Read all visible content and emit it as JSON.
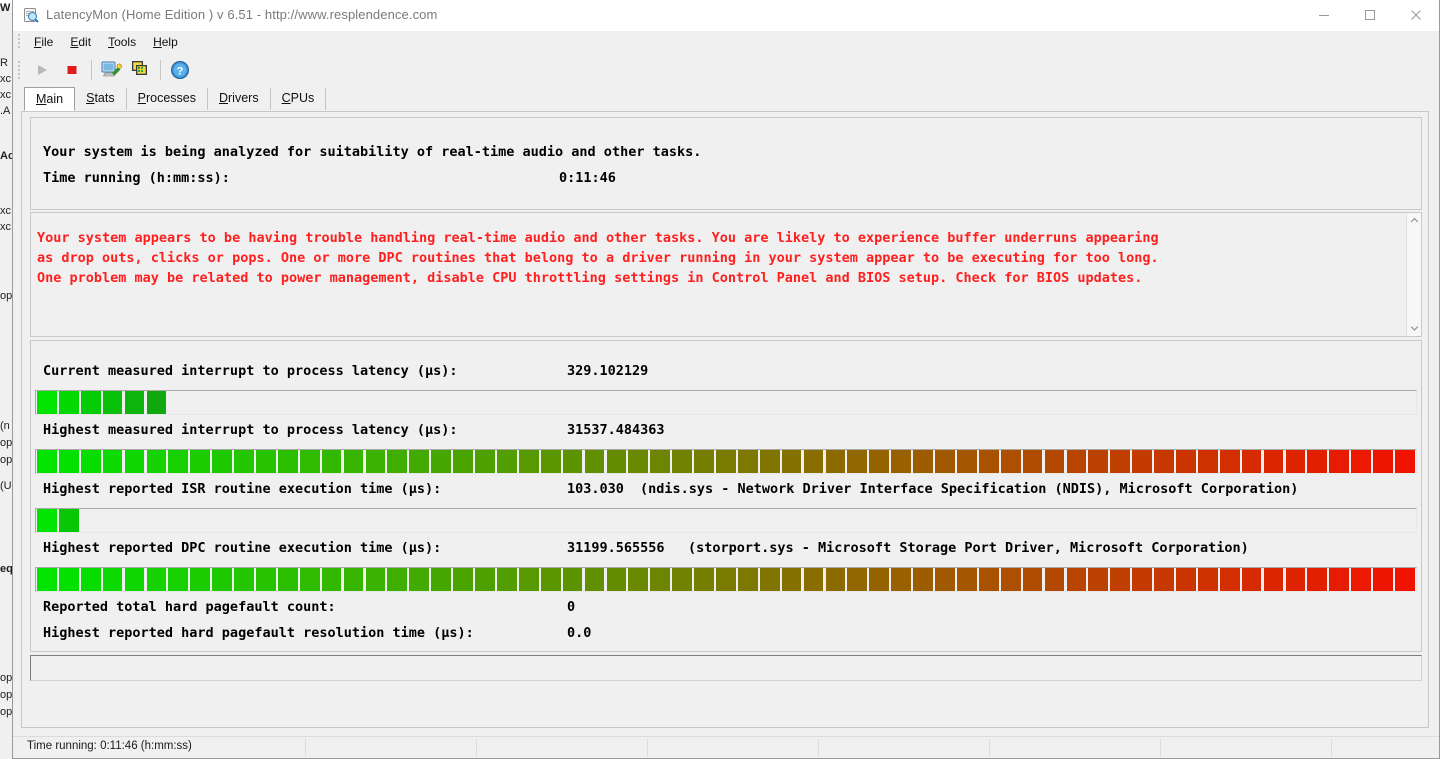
{
  "window": {
    "title": "LatencyMon  (Home Edition )  v 6.51 - http://www.resplendence.com",
    "icon": "latencymon-icon",
    "minimize_label": "Minimize",
    "maximize_label": "Maximize",
    "close_label": "Close"
  },
  "menu": {
    "items": [
      {
        "label": "File",
        "accel": "F"
      },
      {
        "label": "Edit",
        "accel": "E"
      },
      {
        "label": "Tools",
        "accel": "T"
      },
      {
        "label": "Help",
        "accel": "H"
      }
    ]
  },
  "toolbar": {
    "buttons": [
      {
        "name": "start-monitoring-button",
        "icon": "play-icon",
        "enabled": false
      },
      {
        "name": "stop-monitoring-button",
        "icon": "stop-icon",
        "enabled": true
      },
      {
        "name": "system-info-button",
        "icon": "computer-wrench-icon",
        "enabled": true
      },
      {
        "name": "copy-report-button",
        "icon": "copy-windows-icon",
        "enabled": true
      },
      {
        "name": "help-button",
        "icon": "help-question-icon",
        "enabled": true
      }
    ]
  },
  "tabs": [
    {
      "label": "Main",
      "accel": "M",
      "active": true
    },
    {
      "label": "Stats",
      "accel": "S",
      "active": false
    },
    {
      "label": "Processes",
      "accel": "P",
      "active": false
    },
    {
      "label": "Drivers",
      "accel": "D",
      "active": false
    },
    {
      "label": "CPUs",
      "accel": "C",
      "active": false
    }
  ],
  "summary": {
    "headline": "Your system is being analyzed for suitability of real-time audio and other tasks.",
    "time_label": "Time running (h:mm:ss):",
    "time_value": "0:11:46"
  },
  "warning": {
    "color": "#ff1f1f",
    "lines": [
      "Your system appears to be having trouble handling real-time audio and other tasks. You are likely to experience buffer underruns appearing",
      "as drop outs, clicks or pops. One or more DPC routines that belong to a driver running in your system appear to be executing for too long.",
      "One problem may be related to power management, disable CPU throttling settings in Control Panel and BIOS setup. Check for BIOS updates."
    ],
    "scroll_up_icon": "chevron-up-icon",
    "scroll_down_icon": "chevron-down-icon"
  },
  "metrics": [
    {
      "name": "current-interrupt-to-process-latency",
      "label": "Current measured interrupt to process latency (µs):",
      "value": "329.102129",
      "extra": "",
      "bar": {
        "segments": 6,
        "total_segments": 63,
        "start_color": "#00e400",
        "end_color": "#0fa80f",
        "full_width": false
      }
    },
    {
      "name": "highest-interrupt-to-process-latency",
      "label": "Highest measured interrupt to process latency (µs):",
      "value": "31537.484363",
      "extra": "",
      "bar": {
        "segments": 63,
        "total_segments": 63,
        "start_color": "#00e400",
        "end_color": "#f21200",
        "full_width": true
      }
    },
    {
      "name": "highest-isr-routine-execution-time",
      "label": "Highest reported ISR routine execution time (µs):",
      "value": "103.030",
      "extra": "(ndis.sys - Network Driver Interface Specification (NDIS), Microsoft Corporation)",
      "bar": {
        "segments": 2,
        "total_segments": 63,
        "start_color": "#00e400",
        "end_color": "#07c707",
        "full_width": false
      }
    },
    {
      "name": "highest-dpc-routine-execution-time",
      "label": "Highest reported DPC routine execution time (µs):",
      "value": "31199.565556",
      "extra": "(storport.sys - Microsoft Storage Port Driver, Microsoft Corporation)",
      "bar": {
        "segments": 63,
        "total_segments": 63,
        "start_color": "#00e400",
        "end_color": "#f21200",
        "full_width": true
      }
    }
  ],
  "pagefaults": [
    {
      "name": "reported-total-hard-pagefault-count",
      "label": "Reported total hard pagefault count:",
      "value": "0"
    },
    {
      "name": "highest-hard-pagefault-resolution-time",
      "label": "Highest reported hard pagefault resolution time (µs):",
      "value": "0.0"
    }
  ],
  "statusbar": {
    "text": "Time running: 0:11:46  (h:mm:ss)"
  },
  "background_window": {
    "fragments": [
      "W",
      "R",
      "xc",
      "xc",
      ".A",
      "Ac",
      "xc",
      "xc",
      "op",
      "(n",
      "op",
      "op",
      "(U",
      "eq",
      "op",
      "op",
      "op"
    ]
  }
}
